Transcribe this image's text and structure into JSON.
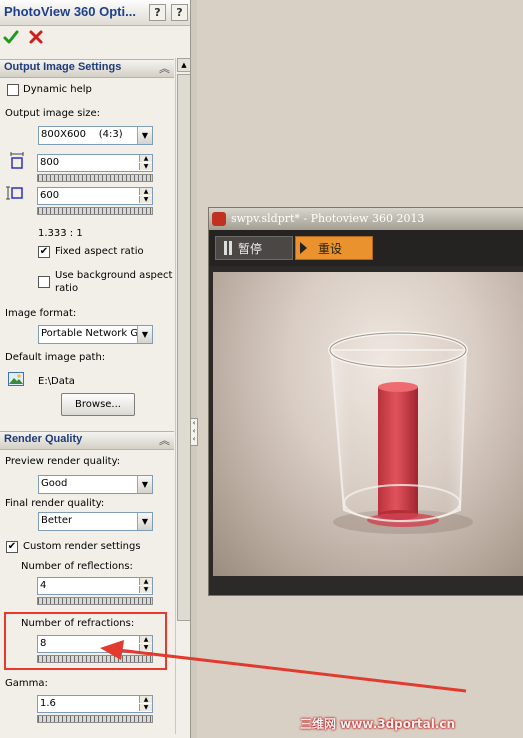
{
  "panel": {
    "title": "PhotoView 360 Opti...",
    "help_btn": "?",
    "pin_btn": "?"
  },
  "output": {
    "header": "Output Image Settings",
    "dynamic_help": "Dynamic help",
    "size_label": "Output image size:",
    "size_value": "800X600    (4:3)",
    "width": "800",
    "height": "600",
    "ratio_text": "1.333 : 1",
    "fixed_aspect": "Fixed aspect ratio",
    "use_bg_aspect_1": "Use background aspect",
    "use_bg_aspect_2": "ratio",
    "format_label": "Image format:",
    "format_value": "Portable Network G",
    "default_path_label": "Default image path:",
    "path_value": "E:\\Data",
    "browse": "Browse..."
  },
  "render": {
    "header": "Render Quality",
    "preview_label": "Preview render quality:",
    "preview_value": "Good",
    "final_label": "Final render quality:",
    "final_value": "Better",
    "custom_label": "Custom render settings",
    "reflections_label": "Number of reflections:",
    "reflections_value": "4",
    "refractions_label": "Number of refractions:",
    "refractions_value": "8",
    "gamma_label": "Gamma:",
    "gamma_value": "1.6"
  },
  "viewer": {
    "title": "swpv.sldprt* - Photoview 360 2013",
    "pause": "暂停",
    "reset": "重设"
  },
  "watermark": "三维网 www.3dportal.cn",
  "colors": {
    "highlight_box": "#e63a2e",
    "arrow": "#e23a2e",
    "reset_button": "#e9922e"
  }
}
